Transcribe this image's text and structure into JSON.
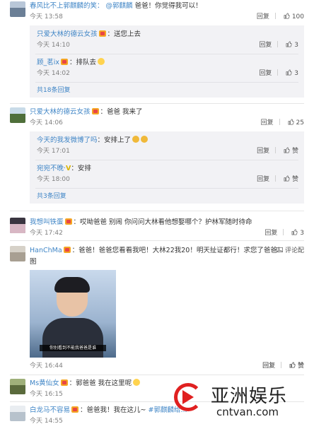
{
  "actions": {
    "reply": "回复",
    "like": "赞"
  },
  "comments": [
    {
      "name": "春风比不上郭麒麟的笑：",
      "mention": "@郭麒麟",
      "text": " 爸爸！你觉得我可以！",
      "time": "今天 13:58",
      "likes": "100",
      "replies": [
        {
          "name": "只爱大林的德云女孩",
          "text": "：送您上去",
          "time": "今天 14:10",
          "likes": "3"
        },
        {
          "name": "顾_茗ix",
          "text": "：排队去",
          "time": "今天 14:02",
          "likes": "3"
        }
      ],
      "more": "共18条回复"
    },
    {
      "name": "只爱大林的德云女孩",
      "text": "：爸爸 我来了",
      "time": "今天 14:06",
      "likes": "25",
      "replies": [
        {
          "name": "今天的我发微博了吗",
          "text": "：安排上了",
          "time": "今天 17:01",
          "likes": "赞"
        },
        {
          "name": "宛宛不晚·",
          "text": "：安排",
          "time": "今天 18:00",
          "likes": "赞"
        }
      ],
      "more": "共3条回复"
    },
    {
      "name": "我想叫铁蛋",
      "text": "：哎呦爸爸 别闹  你问问大林看他想娶哪个？护林军随时待命",
      "time": "今天 17:42",
      "likes": "3"
    },
    {
      "name": "HanChMa",
      "text": "：爸爸！爸爸您看看我吧！大林22我20！明天扯证都行！求您了爸爸！",
      "text2": "图",
      "extra": "评论配",
      "time": "今天 16:44",
      "likes": "赞",
      "image_caption": "你别看到不能我爸爸是谁"
    },
    {
      "name": "Ms黄仙女",
      "text": "：郭爸爸 我在这里呢",
      "time": "今天 16:15",
      "likes": "赞"
    },
    {
      "name": "白龙马不容易",
      "text": "：爸爸我！我在这儿~",
      "mention": "#郭麒麟给...",
      "time": "今天 14:55",
      "likes": ""
    }
  ],
  "watermark": {
    "title": "亚洲娱乐",
    "site": "cntvan.com"
  },
  "colors": {
    "name": "#eb7350",
    "link": "#3f85c6",
    "reply_bg": "#f2f2f5",
    "logo_red": "#e02020"
  }
}
